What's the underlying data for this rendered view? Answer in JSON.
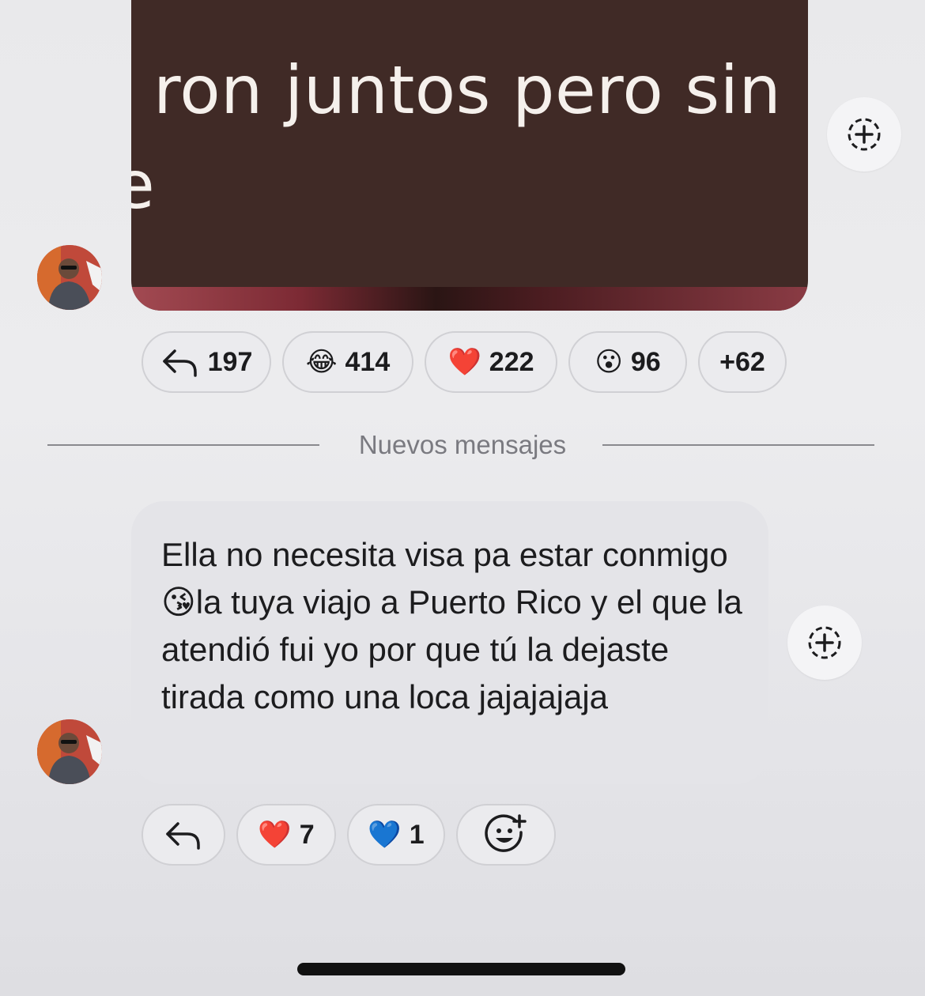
{
  "media_post": {
    "text_line1": "ron juntos pero sin",
    "text_line2": "e"
  },
  "post_reactions": [
    {
      "icon": "reply-arrow-icon",
      "count": "197"
    },
    {
      "icon": "😂",
      "count": "414"
    },
    {
      "icon": "❤️",
      "count": "222"
    },
    {
      "icon": "😮",
      "count": "96"
    },
    {
      "icon": "",
      "count": "+62"
    }
  ],
  "divider": {
    "label": "Nuevos mensajes"
  },
  "message": {
    "text_before_emoji": "Ella no necesita visa pa estar conmigo ",
    "emoji": "😘",
    "text_after_emoji": "la tuya viajo a Puerto Rico y el que la atendió fui yo por que tú la dejaste tirada como una loca jajajajaja"
  },
  "message_reactions": [
    {
      "icon": "reply-arrow-icon",
      "count": ""
    },
    {
      "icon": "❤️",
      "count": "7"
    },
    {
      "icon": "💙",
      "count": "1"
    },
    {
      "icon": "add-reaction-icon",
      "count": ""
    }
  ],
  "colors": {
    "media_background": "#402a26",
    "bubble_background": "#e4e4e8",
    "pill_border": "#d0d0d4"
  }
}
